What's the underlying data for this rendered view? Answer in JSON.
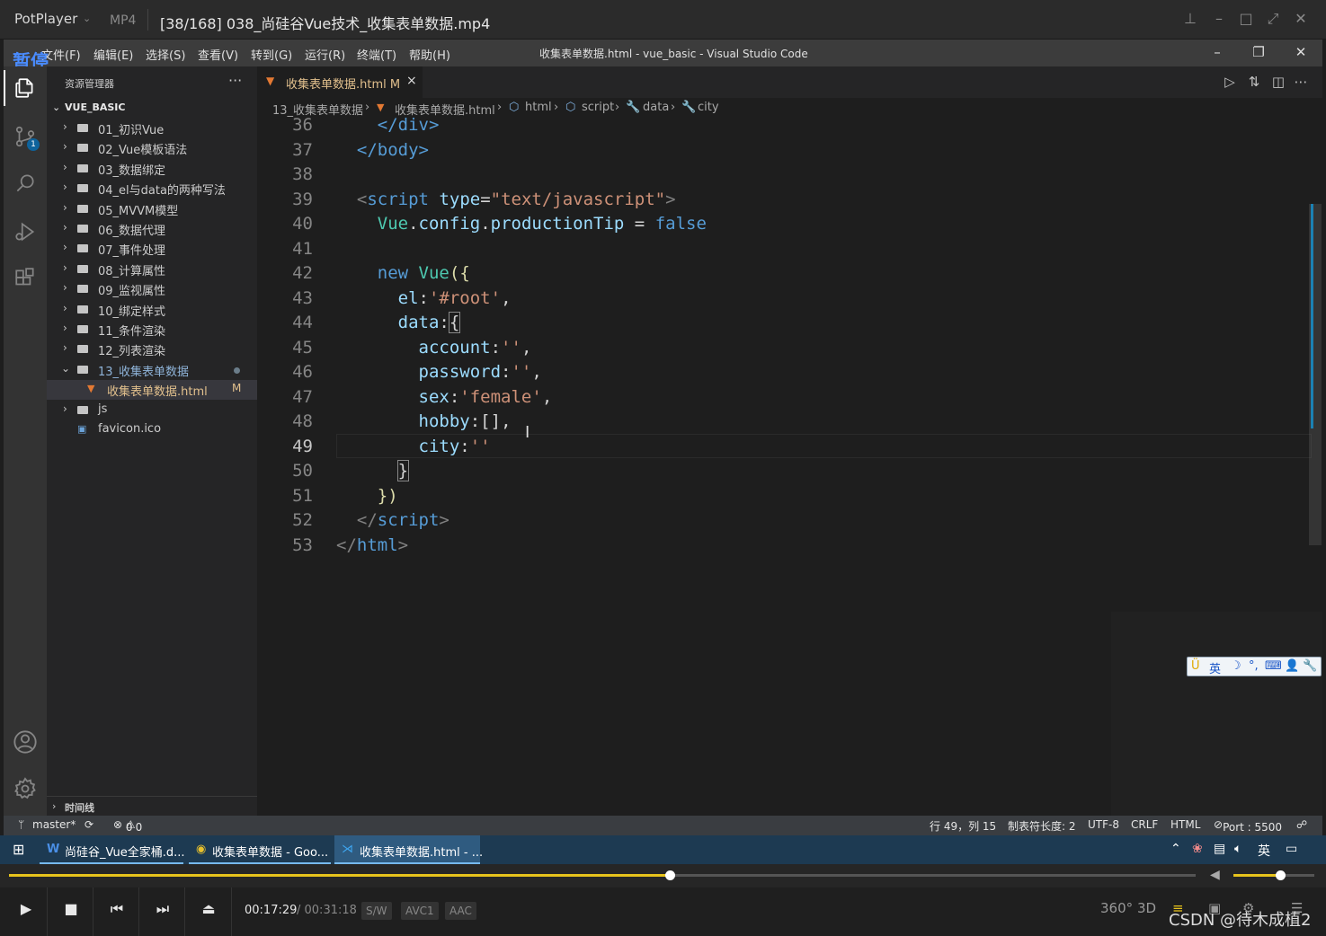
{
  "player": {
    "brand": "PotPlayer",
    "format": "MP4",
    "file_title": "[38/168] 038_尚硅谷Vue技术_收集表单数据.mp4",
    "pause_label": "暂停",
    "time_current": "00:17:29",
    "time_total": "00:31:18",
    "chips": [
      "S/W",
      "AVC1",
      "AAC"
    ],
    "right_icons": [
      "360°",
      "3D"
    ],
    "progress": 0.557,
    "volume": 0.58,
    "watermark": "CSDN @待木成植2"
  },
  "vscode": {
    "menu": [
      "文件(F)",
      "编辑(E)",
      "选择(S)",
      "查看(V)",
      "转到(G)",
      "运行(R)",
      "终端(T)",
      "帮助(H)"
    ],
    "window_title": "收集表单数据.html - vue_basic - Visual Studio Code",
    "activity": [
      "explorer-icon",
      "source-control-icon",
      "search-icon",
      "run-debug-icon",
      "extensions-icon",
      "account-icon",
      "settings-icon"
    ],
    "scm_badge": "1",
    "explorer": {
      "title": "资源管理器",
      "more": "···",
      "project": "VUE_BASIC",
      "items": [
        {
          "label": "01_初识Vue"
        },
        {
          "label": "02_Vue模板语法"
        },
        {
          "label": "03_数据绑定"
        },
        {
          "label": "04_el与data的两种写法"
        },
        {
          "label": "05_MVVM模型"
        },
        {
          "label": "06_数据代理"
        },
        {
          "label": "07_事件处理"
        },
        {
          "label": "08_计算属性"
        },
        {
          "label": "09_监视属性"
        },
        {
          "label": "10_绑定样式"
        },
        {
          "label": "11_条件渲染"
        },
        {
          "label": "12_列表渲染"
        },
        {
          "label": "13_收集表单数据"
        },
        {
          "label": "收集表单数据.html",
          "status": "M"
        },
        {
          "label": "js"
        },
        {
          "label": "favicon.ico"
        }
      ],
      "timeline": "时间线"
    },
    "tab": {
      "name": "收集表单数据.html",
      "status": "M",
      "close": "×"
    },
    "breadcrumb": [
      "13_收集表单数据",
      "收集表单数据.html",
      "html",
      "script",
      "data",
      "city"
    ],
    "line_numbers": [
      "36",
      "37",
      "38",
      "39",
      "40",
      "41",
      "42",
      "43",
      "44",
      "45",
      "46",
      "47",
      "48",
      "49",
      "50",
      "51",
      "52",
      "53"
    ],
    "current_line": "49",
    "code": {
      "l36_close_div": "</div>",
      "l37_close_body": "</body>",
      "l39_script": "script",
      "l39_attr": "type",
      "l39_value": "\"text/javascript\"",
      "l40_vue": "Vue",
      "l40_config": "config",
      "l40_prop": "productionTip",
      "l40_value": "false",
      "l42_new": "new",
      "l42_vue": "Vue",
      "l43_key": "el",
      "l43_value": "'#root'",
      "l44_key": "data",
      "l45_key": "account",
      "l45_value": "''",
      "l46_key": "password",
      "l46_value": "''",
      "l47_key": "sex",
      "l47_value": "'female'",
      "l48_key": "hobby",
      "l48_value": "[]",
      "l49_key": "city",
      "l49_value": "''",
      "l52_close_script": "script",
      "l53_close_html": "html"
    },
    "status": {
      "branch": "master*",
      "errors": "0",
      "warnings": "0",
      "position": "行 49，列 15",
      "tab_size": "制表符长度: 2",
      "encoding": "UTF-8",
      "eol": "CRLF",
      "language": "HTML",
      "port": "Port : 5500"
    },
    "ime": [
      "英",
      "☽",
      "°,",
      "⌨",
      "👤",
      "🔧"
    ]
  },
  "taskbar": {
    "items": [
      {
        "label": "尚硅谷_Vue全家桶.d...",
        "icon": "word-icon"
      },
      {
        "label": "收集表单数据 - Goo...",
        "icon": "chrome-icon"
      },
      {
        "label": "收集表单数据.html - ...",
        "icon": "vscode-icon"
      }
    ],
    "lang": "英"
  }
}
